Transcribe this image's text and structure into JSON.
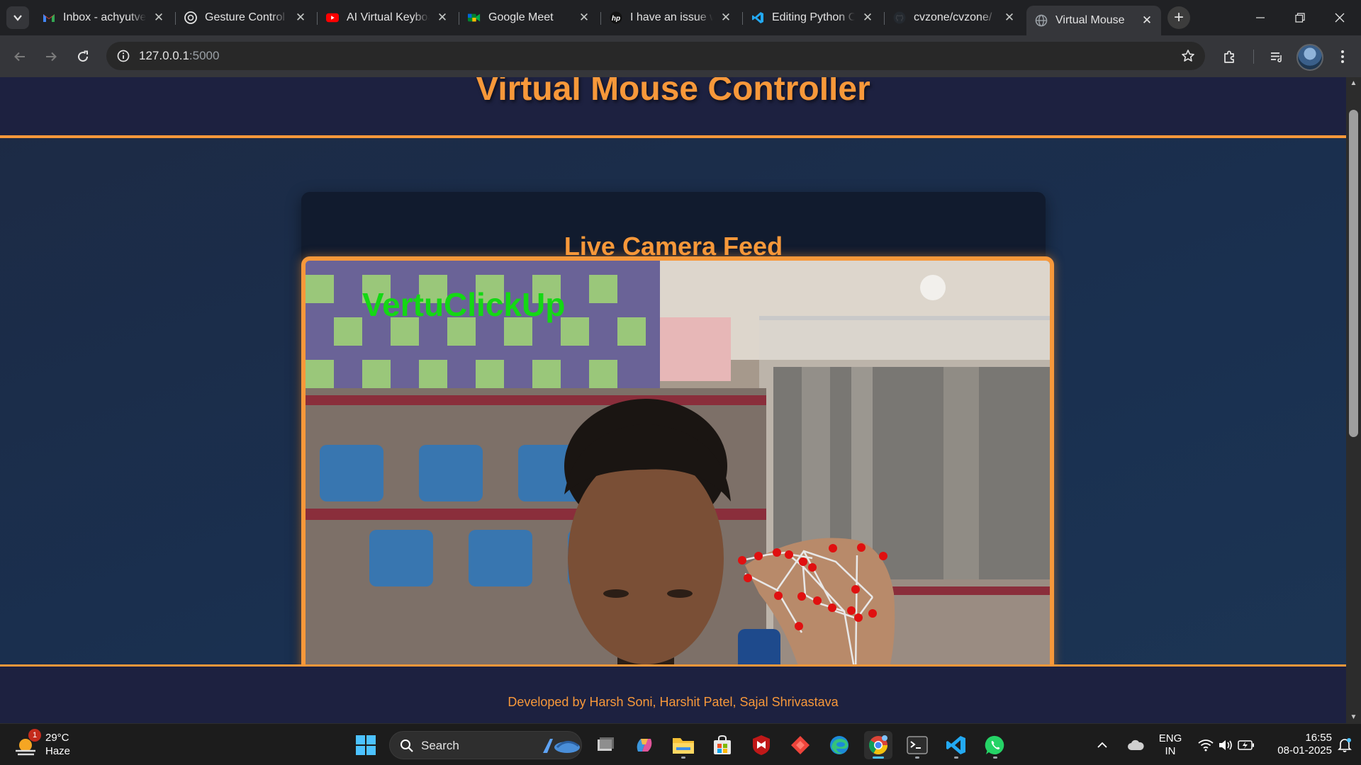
{
  "browser": {
    "tabs": [
      {
        "title": "Inbox - achyutve",
        "icon": "gmail-icon",
        "active": false
      },
      {
        "title": "Gesture Control",
        "icon": "chatgpt-icon",
        "active": false
      },
      {
        "title": "AI Virtual Keyboa",
        "icon": "youtube-icon",
        "active": false
      },
      {
        "title": "Google Meet",
        "icon": "google-meet-icon",
        "active": false
      },
      {
        "title": "I have an issue w",
        "icon": "hp-icon",
        "active": false
      },
      {
        "title": "Editing Python C",
        "icon": "vscode-icon",
        "active": false
      },
      {
        "title": "cvzone/cvzone/",
        "icon": "github-icon",
        "active": false
      },
      {
        "title": "Virtual Mouse",
        "icon": "globe-icon",
        "active": true
      }
    ],
    "url_host": "127.0.0.1",
    "url_port": ":5000"
  },
  "page": {
    "title": "Virtual Mouse Controller",
    "section_title": "Live Camera Feed",
    "video_overlay_text": "VertuClickUp",
    "footer": "Developed by Harsh Soni, Harshit Patel, Sajal Shrivastava"
  },
  "taskbar": {
    "weather_temp": "29°C",
    "weather_cond": "Haze",
    "weather_badge": "1",
    "search_label": "Search",
    "lang_top": "ENG",
    "lang_bottom": "IN",
    "time": "16:55",
    "date": "08-01-2025"
  },
  "colors": {
    "accent": "#f7983a",
    "header_bg": "#1d2140",
    "landmark": "#e01010"
  }
}
